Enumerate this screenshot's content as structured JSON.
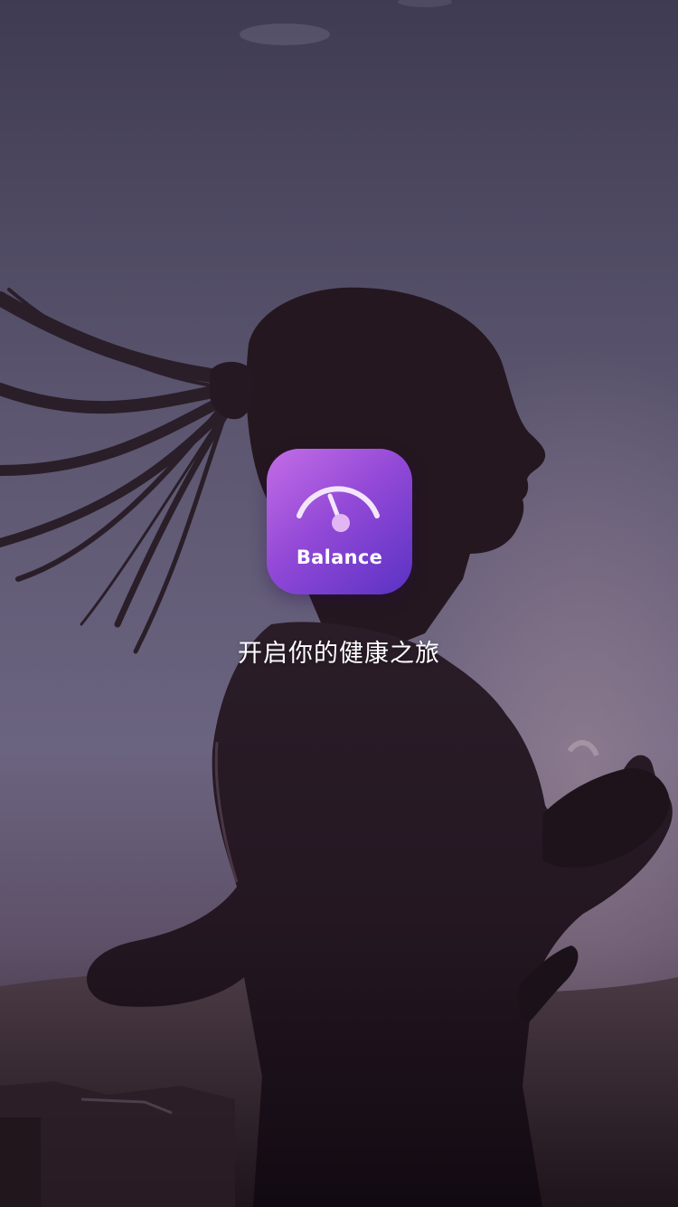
{
  "app": {
    "name": "Balance",
    "tagline": "开启你的健康之旅"
  },
  "logo": {
    "icon": "gauge-icon",
    "gradient": [
      "#c36de6",
      "#9148d6",
      "#5a32c4"
    ]
  },
  "background": {
    "description_icon": "runner-silhouette-image",
    "sky_color": "#5e5772",
    "silhouette_color": "#1c1420"
  }
}
